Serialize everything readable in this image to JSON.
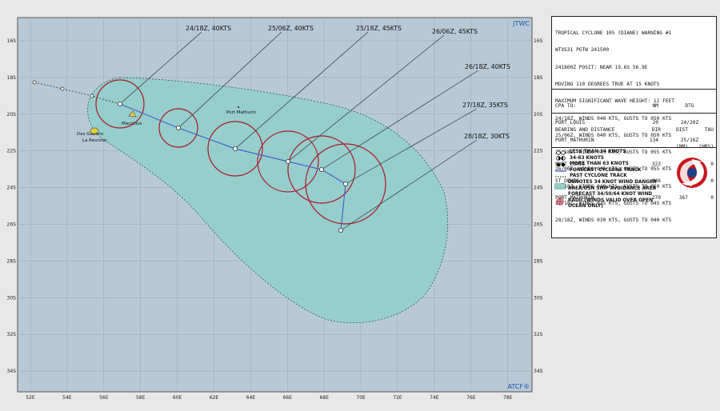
{
  "map": {
    "agency_top": "JTWC",
    "agency_bottom": "ATCF®",
    "lon_ticks": [
      "52E",
      "54E",
      "56E",
      "58E",
      "60E",
      "62E",
      "64E",
      "66E",
      "68E",
      "70E",
      "72E",
      "74E",
      "76E",
      "78E"
    ],
    "lat_ticks": [
      "16S",
      "18S",
      "20S",
      "22S",
      "24S",
      "26S",
      "28S",
      "30S",
      "32S",
      "34S"
    ],
    "places": {
      "port_mathurin": "Port Mathurin",
      "mauritius": "Mauritius",
      "des_gaulets": "Des Gaulets",
      "la_reunion": "La Reunion"
    },
    "forecast_labels": [
      {
        "id": "24-18",
        "text": "24/18Z, 40KTS"
      },
      {
        "id": "25-06",
        "text": "25/06Z, 40KTS"
      },
      {
        "id": "25-18",
        "text": "25/18Z, 45KTS"
      },
      {
        "id": "26-06",
        "text": "26/06Z, 45KTS"
      },
      {
        "id": "26-18",
        "text": "26/18Z, 40KTS"
      },
      {
        "id": "27-18",
        "text": "27/18Z, 35KTS"
      },
      {
        "id": "28-18",
        "text": "28/18Z, 30KTS"
      }
    ],
    "colors": {
      "ocean": "#b7c9d6",
      "danger_area": "#8fcfca",
      "wind_radii": "#b0152a",
      "track": "#4a63c7",
      "grid": "#9aa6b0"
    }
  },
  "warning": {
    "lines": [
      "TROPICAL CYCLONE 10S (DIANE) WARNING #1",
      "WTXS31 PGTW 241500",
      "241800Z POSIT: NEAR 19.6S 56.9E",
      "MOVING 110 DEGREES TRUE AT 15 KNOTS",
      "MAXIMUM SIGNIFICANT WAVE HEIGHT: 12 FEET",
      "24/18Z, WINDS 040 KTS, GUSTS TO 050 KTS",
      "25/06Z, WINDS 040 KTS, GUSTS TO 050 KTS",
      "25/18Z, WINDS 045 KTS, GUSTS TO 055 KTS",
      "26/06Z, WINDS 045 KTS, GUSTS TO 055 KTS",
      "26/18Z, WINDS 040 KTS, GUSTS TO 050 KTS",
      "27/18Z, WINDS 035 KTS, GUSTS TO 045 KTS",
      "28/18Z, WINDS 030 KTS, GUSTS TO 040 KTS"
    ]
  },
  "cpa": {
    "header": [
      "CPA TO:",
      "NM",
      "DTG"
    ],
    "rows": [
      [
        "PORT_LOUIS",
        "20",
        "24/20Z"
      ],
      [
        "PORT_MATHURIN",
        "134",
        "25/16Z"
      ]
    ]
  },
  "bearing": {
    "header": [
      "BEARING AND DISTANCE",
      "DIR",
      "DIST",
      "TAU"
    ],
    "subheader": [
      "",
      "",
      "(NM)",
      "(HRS)"
    ],
    "rows": [
      [
        "PORT_LOUIS",
        "323",
        "38",
        "0"
      ],
      [
        "ST_DENIS",
        "046",
        "111",
        "0"
      ],
      [
        "PORT_MATHURIN",
        "270",
        "367",
        "0"
      ]
    ]
  },
  "legend": {
    "items": [
      "LESS THAN 34 KNOTS",
      "34-63 KNOTS",
      "MORE THAN 63 KNOTS",
      "FORECAST CYCLONE TRACK",
      "PAST CYCLONE TRACK",
      "DENOTES 34 KNOT WIND DANGER AREA/USN SHIP AVOIDANCE AREA",
      "FORECAST 34/50/64 KNOT WIND RADII (WINDS VALID OVER OPEN OCEAN ONLY)"
    ]
  }
}
